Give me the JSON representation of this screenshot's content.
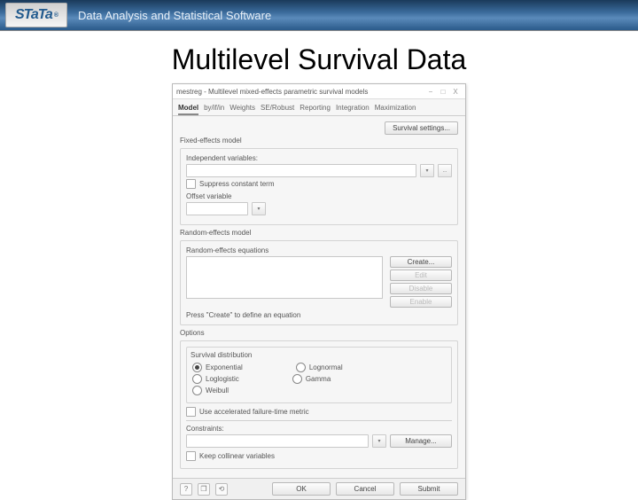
{
  "banner": {
    "logo": "STaTa",
    "reg": "®",
    "tagline": "Data Analysis and Statistical Software"
  },
  "slide_title": "Multilevel Survival Data",
  "dialog": {
    "title": "mestreg - Multilevel mixed-effects parametric survival models",
    "win": {
      "min": "−",
      "max": "□",
      "close": "X"
    },
    "tabs": [
      "Model",
      "by/if/in",
      "Weights",
      "SE/Robust",
      "Reporting",
      "Integration",
      "Maximization"
    ],
    "survival_settings": "Survival settings...",
    "fixed": {
      "heading": "Fixed-effects model",
      "indep_label": "Independent variables:",
      "dd_more": "...",
      "suppress": "Suppress constant term",
      "offset": "Offset variable"
    },
    "random": {
      "heading": "Random-effects model",
      "eq_label": "Random-effects equations",
      "buttons": {
        "create": "Create...",
        "edit": "Edit",
        "disable": "Disable",
        "enable": "Enable"
      },
      "hint": "Press \"Create\" to define an equation"
    },
    "options": {
      "heading": "Options",
      "dist_label": "Survival distribution",
      "dists": {
        "exp": "Exponential",
        "loglog": "Loglogistic",
        "weibull": "Weibull",
        "lognorm": "Lognormal",
        "gamma": "Gamma"
      },
      "aft": "Use accelerated failure-time metric",
      "constraints": "Constraints:",
      "manage": "Manage...",
      "keep": "Keep collinear variables"
    },
    "footer": {
      "help": "?",
      "copy": "❐",
      "reset": "⟲",
      "ok": "OK",
      "cancel": "Cancel",
      "submit": "Submit"
    }
  }
}
